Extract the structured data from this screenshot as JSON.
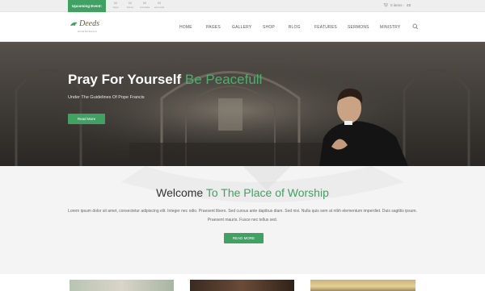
{
  "topbar": {
    "event_label": "Upcoming Event:",
    "countdown": [
      {
        "value": "00",
        "label": "days"
      },
      {
        "value": "00",
        "label": "hours"
      },
      {
        "value": "00",
        "label": "minutes"
      },
      {
        "value": "00",
        "label": "seconds"
      }
    ],
    "cart_text": "0 items -",
    "cart_price": "£0"
  },
  "header": {
    "logo_text": "Deeds",
    "logo_sub": "WORDPRESS",
    "nav": [
      "HOME",
      "PAGES",
      "GALLERY",
      "SHOP",
      "BLOG",
      "FEATURES",
      "SERMONS",
      "MINISTRY"
    ]
  },
  "hero": {
    "title_main": "Pray For Yourself",
    "title_accent": "Be Peacefull",
    "subtitle": "Under The Guidelines Of Pope Francis",
    "button": "Read More"
  },
  "welcome": {
    "title_main": "Welcome",
    "title_accent": "To The Place of Worship",
    "text": "Lorem ipsum dolor sit amet, consectetur adipiscing elit. Integer nec odio. Praesent libero. Sed cursus ante dapibus diam. Sed nisi. Nulla quis sem at nibh elementum imperdiet. Duis sagittis ipsum. Praesent mauris. Fusce nec tellus sed.",
    "button": "READ MORE"
  },
  "colors": {
    "accent": "#3fa162",
    "hero_accent": "#45b36c"
  }
}
